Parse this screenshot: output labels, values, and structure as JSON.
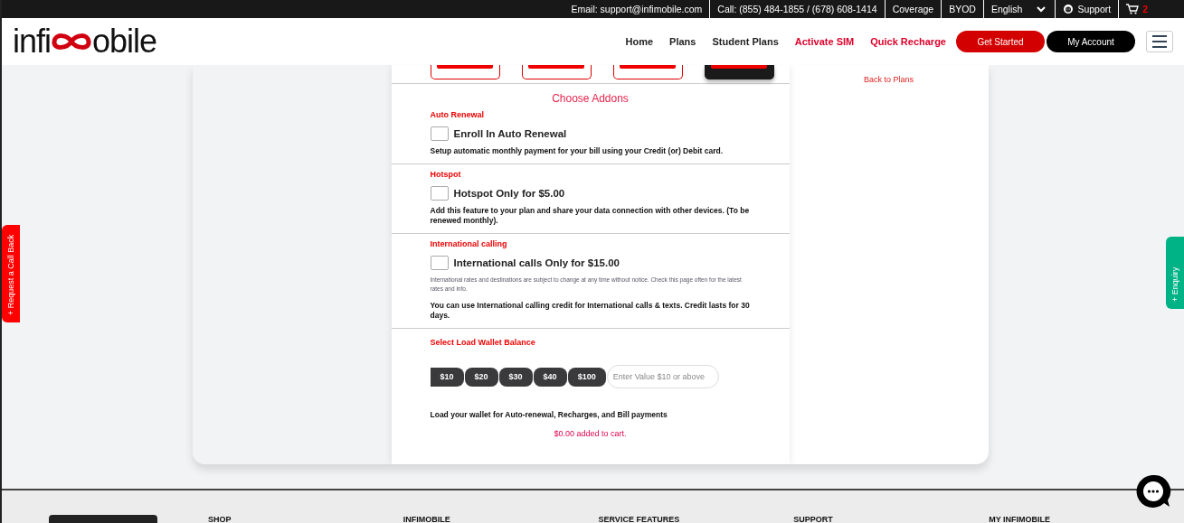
{
  "top_bar": {
    "email": "Email: support@infimobile.com",
    "phone": "Call: (855) 484-1855 / (678) 608-1414",
    "links": [
      "Coverage",
      "BYOD"
    ],
    "language": "English",
    "support": "Support",
    "cart_count": "2"
  },
  "header": {
    "logo_left": "infi",
    "logo_right": "obile",
    "nav": [
      {
        "label": "Home",
        "highlight": false
      },
      {
        "label": "Plans",
        "highlight": false
      },
      {
        "label": "Student Plans",
        "highlight": false
      },
      {
        "label": "Activate SIM",
        "highlight": true
      },
      {
        "label": "Quick Recharge",
        "highlight": true
      }
    ],
    "get_started": "Get Started",
    "my_account": "My Account"
  },
  "plan_options": [
    {
      "selected": false
    },
    {
      "selected": false
    },
    {
      "selected": false
    },
    {
      "selected": true
    }
  ],
  "back_link": "Back to Plans",
  "addons": {
    "title": "Choose Addons",
    "sections": [
      {
        "heading": "Auto Renewal",
        "label": "Enroll In Auto Renewal",
        "checked": false,
        "description": "Setup automatic monthly payment for your bill using your Credit (or) Debit card."
      },
      {
        "heading": "Hotspot",
        "label": "Hotspot Only for $5.00",
        "checked": false,
        "description": "Add this feature to your plan and share your data connection with other devices. (To be renewed monthly)."
      },
      {
        "heading": "International calling",
        "label": "International calls Only for $15.00",
        "checked": false,
        "note": "International rates and destinations are subject to change at any time without notice. Check this page often for the latest rates and info.",
        "description": "You can use International calling credit for International calls & texts. Credit lasts for 30 days."
      }
    ]
  },
  "wallet": {
    "heading": "Select Load Wallet Balance",
    "amounts": [
      {
        "label": "$10",
        "selected": false
      },
      {
        "label": "$20",
        "selected": false
      },
      {
        "label": "$30",
        "selected": false
      },
      {
        "label": "$40",
        "selected": false
      },
      {
        "label": "$100",
        "selected": false
      }
    ],
    "placeholder": "Enter Value $10 or above",
    "description": "Load your wallet for Auto-renewal, Recharges, and Bill payments",
    "cart_status": "$0.00 added to cart."
  },
  "side_tabs": {
    "left": "+ Request a Call Back",
    "right": "+ Enquiry"
  },
  "footer": {
    "headings": [
      "SHOP",
      "INFIMOBILE",
      "SERVICE FEATURES",
      "SUPPORT",
      "MY INFIMOBILE"
    ]
  }
}
